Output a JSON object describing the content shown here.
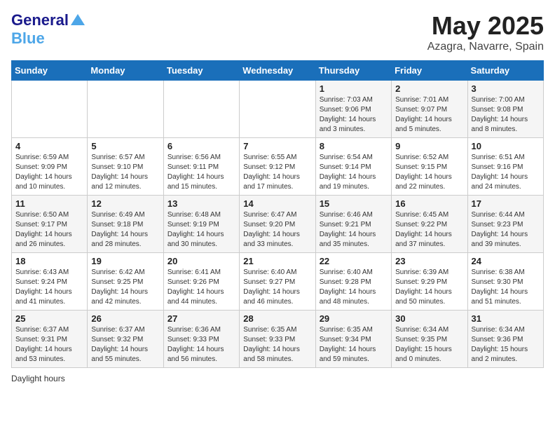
{
  "header": {
    "logo_line1": "General",
    "logo_line2": "Blue",
    "main_title": "May 2025",
    "subtitle": "Azagra, Navarre, Spain"
  },
  "weekdays": [
    "Sunday",
    "Monday",
    "Tuesday",
    "Wednesday",
    "Thursday",
    "Friday",
    "Saturday"
  ],
  "footer": {
    "daylight_label": "Daylight hours"
  },
  "weeks": [
    [
      {
        "day": "",
        "sunrise": "",
        "sunset": "",
        "daylight": ""
      },
      {
        "day": "",
        "sunrise": "",
        "sunset": "",
        "daylight": ""
      },
      {
        "day": "",
        "sunrise": "",
        "sunset": "",
        "daylight": ""
      },
      {
        "day": "",
        "sunrise": "",
        "sunset": "",
        "daylight": ""
      },
      {
        "day": "1",
        "sunrise": "7:03 AM",
        "sunset": "9:06 PM",
        "daylight": "14 hours and 3 minutes."
      },
      {
        "day": "2",
        "sunrise": "7:01 AM",
        "sunset": "9:07 PM",
        "daylight": "14 hours and 5 minutes."
      },
      {
        "day": "3",
        "sunrise": "7:00 AM",
        "sunset": "9:08 PM",
        "daylight": "14 hours and 8 minutes."
      }
    ],
    [
      {
        "day": "4",
        "sunrise": "6:59 AM",
        "sunset": "9:09 PM",
        "daylight": "14 hours and 10 minutes."
      },
      {
        "day": "5",
        "sunrise": "6:57 AM",
        "sunset": "9:10 PM",
        "daylight": "14 hours and 12 minutes."
      },
      {
        "day": "6",
        "sunrise": "6:56 AM",
        "sunset": "9:11 PM",
        "daylight": "14 hours and 15 minutes."
      },
      {
        "day": "7",
        "sunrise": "6:55 AM",
        "sunset": "9:12 PM",
        "daylight": "14 hours and 17 minutes."
      },
      {
        "day": "8",
        "sunrise": "6:54 AM",
        "sunset": "9:14 PM",
        "daylight": "14 hours and 19 minutes."
      },
      {
        "day": "9",
        "sunrise": "6:52 AM",
        "sunset": "9:15 PM",
        "daylight": "14 hours and 22 minutes."
      },
      {
        "day": "10",
        "sunrise": "6:51 AM",
        "sunset": "9:16 PM",
        "daylight": "14 hours and 24 minutes."
      }
    ],
    [
      {
        "day": "11",
        "sunrise": "6:50 AM",
        "sunset": "9:17 PM",
        "daylight": "14 hours and 26 minutes."
      },
      {
        "day": "12",
        "sunrise": "6:49 AM",
        "sunset": "9:18 PM",
        "daylight": "14 hours and 28 minutes."
      },
      {
        "day": "13",
        "sunrise": "6:48 AM",
        "sunset": "9:19 PM",
        "daylight": "14 hours and 30 minutes."
      },
      {
        "day": "14",
        "sunrise": "6:47 AM",
        "sunset": "9:20 PM",
        "daylight": "14 hours and 33 minutes."
      },
      {
        "day": "15",
        "sunrise": "6:46 AM",
        "sunset": "9:21 PM",
        "daylight": "14 hours and 35 minutes."
      },
      {
        "day": "16",
        "sunrise": "6:45 AM",
        "sunset": "9:22 PM",
        "daylight": "14 hours and 37 minutes."
      },
      {
        "day": "17",
        "sunrise": "6:44 AM",
        "sunset": "9:23 PM",
        "daylight": "14 hours and 39 minutes."
      }
    ],
    [
      {
        "day": "18",
        "sunrise": "6:43 AM",
        "sunset": "9:24 PM",
        "daylight": "14 hours and 41 minutes."
      },
      {
        "day": "19",
        "sunrise": "6:42 AM",
        "sunset": "9:25 PM",
        "daylight": "14 hours and 42 minutes."
      },
      {
        "day": "20",
        "sunrise": "6:41 AM",
        "sunset": "9:26 PM",
        "daylight": "14 hours and 44 minutes."
      },
      {
        "day": "21",
        "sunrise": "6:40 AM",
        "sunset": "9:27 PM",
        "daylight": "14 hours and 46 minutes."
      },
      {
        "day": "22",
        "sunrise": "6:40 AM",
        "sunset": "9:28 PM",
        "daylight": "14 hours and 48 minutes."
      },
      {
        "day": "23",
        "sunrise": "6:39 AM",
        "sunset": "9:29 PM",
        "daylight": "14 hours and 50 minutes."
      },
      {
        "day": "24",
        "sunrise": "6:38 AM",
        "sunset": "9:30 PM",
        "daylight": "14 hours and 51 minutes."
      }
    ],
    [
      {
        "day": "25",
        "sunrise": "6:37 AM",
        "sunset": "9:31 PM",
        "daylight": "14 hours and 53 minutes."
      },
      {
        "day": "26",
        "sunrise": "6:37 AM",
        "sunset": "9:32 PM",
        "daylight": "14 hours and 55 minutes."
      },
      {
        "day": "27",
        "sunrise": "6:36 AM",
        "sunset": "9:33 PM",
        "daylight": "14 hours and 56 minutes."
      },
      {
        "day": "28",
        "sunrise": "6:35 AM",
        "sunset": "9:33 PM",
        "daylight": "14 hours and 58 minutes."
      },
      {
        "day": "29",
        "sunrise": "6:35 AM",
        "sunset": "9:34 PM",
        "daylight": "14 hours and 59 minutes."
      },
      {
        "day": "30",
        "sunrise": "6:34 AM",
        "sunset": "9:35 PM",
        "daylight": "15 hours and 0 minutes."
      },
      {
        "day": "31",
        "sunrise": "6:34 AM",
        "sunset": "9:36 PM",
        "daylight": "15 hours and 2 minutes."
      }
    ]
  ]
}
